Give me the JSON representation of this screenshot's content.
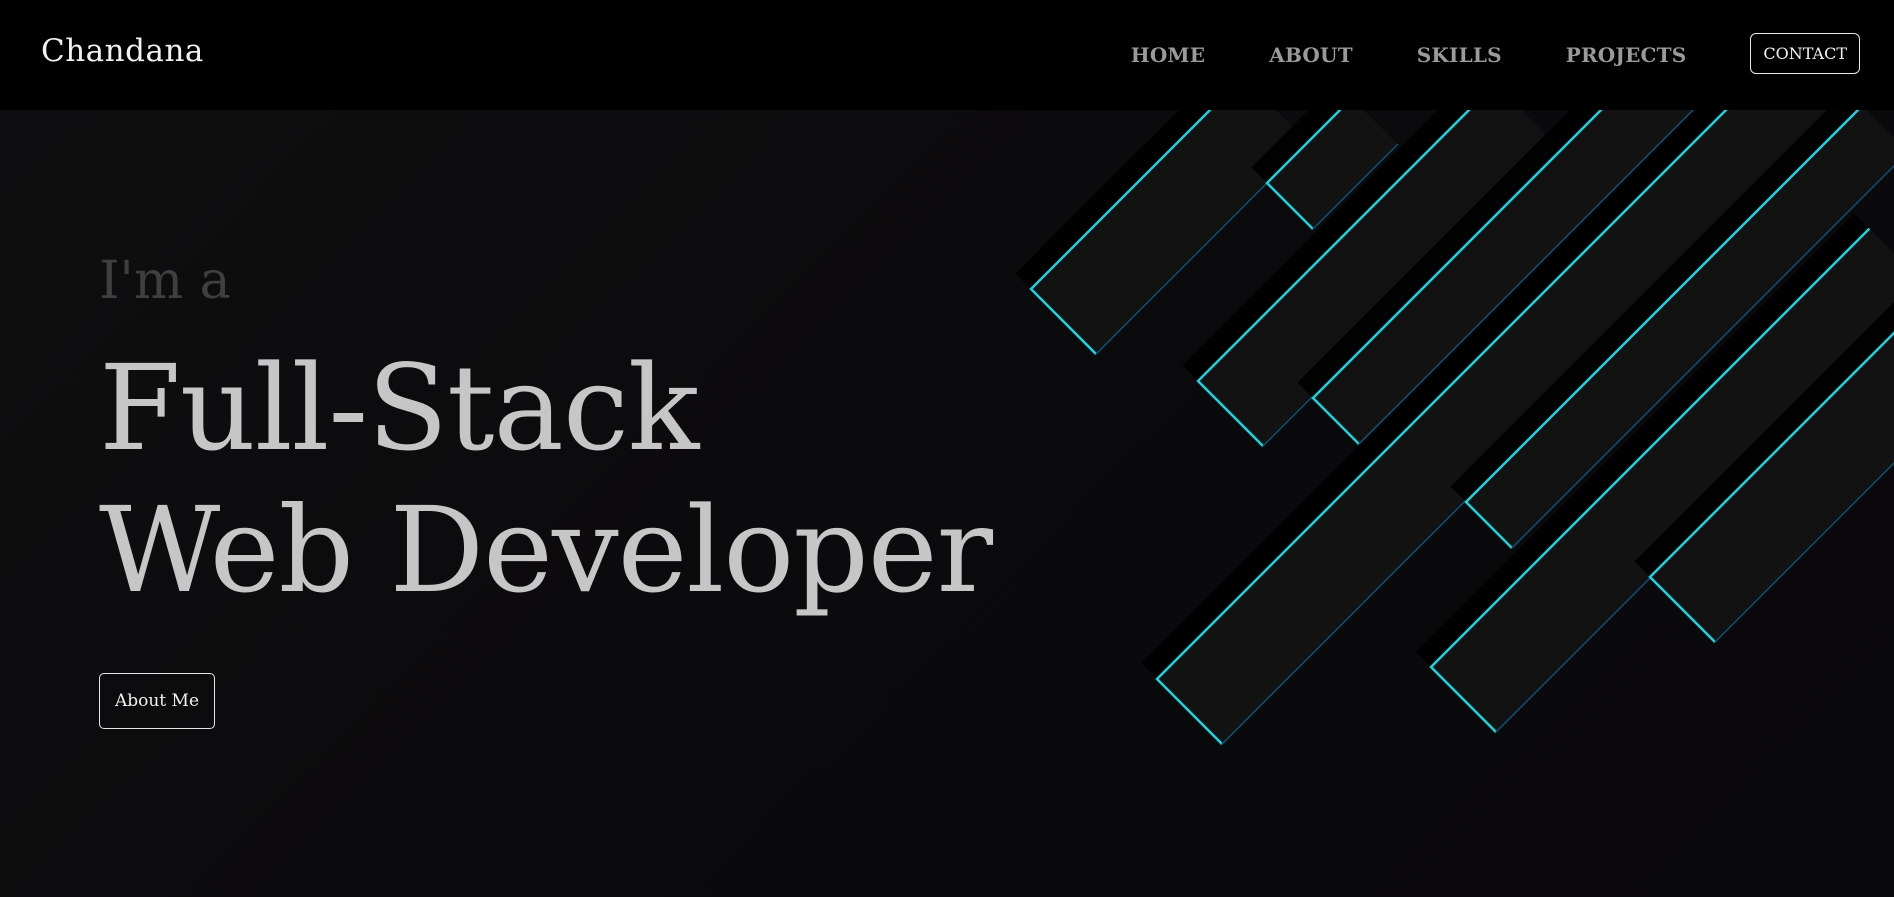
{
  "navbar": {
    "brand": "Chandana",
    "links": [
      {
        "label": "HOME"
      },
      {
        "label": "ABOUT"
      },
      {
        "label": "SKILLS"
      },
      {
        "label": "PROJECTS"
      }
    ],
    "contact_label": "CONTACT"
  },
  "hero": {
    "intro": "I'm a",
    "headline_line1": "Full-Stack",
    "headline_line2": "Web Developer",
    "button_label": "About Me"
  },
  "colors": {
    "accent": "#1fd1dc",
    "navbar_bg": "#000000",
    "page_bg": "#0b0a0c",
    "headline": "#c6c6c6",
    "intro": "#3f3f3f",
    "nav_link": "#9a9a9a"
  }
}
